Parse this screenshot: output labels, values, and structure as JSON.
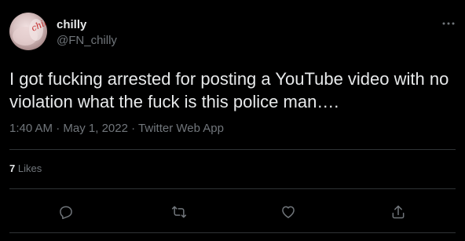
{
  "author": {
    "display_name": "chilly",
    "handle": "@FN_chilly",
    "avatar_text": "chilly"
  },
  "tweet": {
    "text": "I got fucking arrested for posting a YouTube video with no violation what the fuck is this police man….",
    "time": "1:40 AM",
    "separator": "·",
    "date": "May 1, 2022",
    "source": "Twitter Web App"
  },
  "stats": {
    "likes_count": "7",
    "likes_label": "Likes"
  },
  "icons": {
    "more": "more-horizontal-icon",
    "reply": "reply-icon",
    "retweet": "retweet-icon",
    "like": "heart-icon",
    "share": "share-icon"
  },
  "colors": {
    "background": "#000000",
    "text_primary": "#e7e9ea",
    "text_secondary": "#71767b",
    "divider": "#2f3336"
  }
}
